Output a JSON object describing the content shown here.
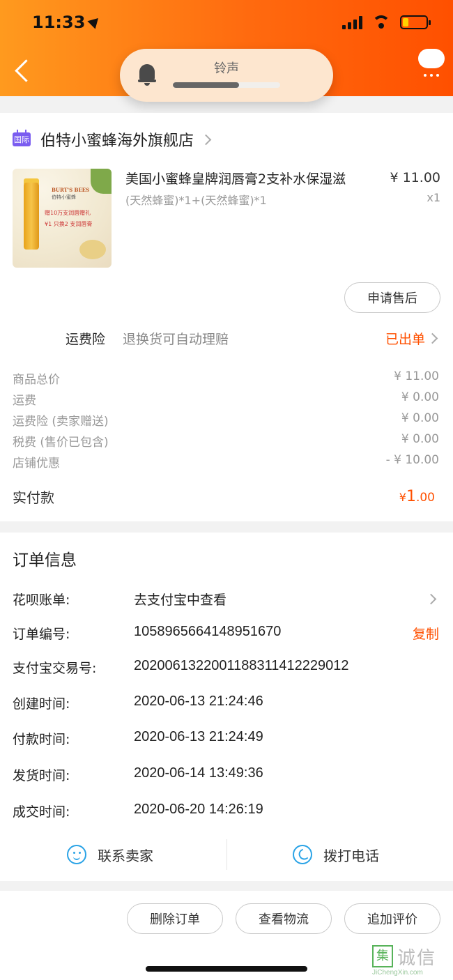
{
  "status_bar": {
    "time": "11:33"
  },
  "ringer": {
    "label": "铃声",
    "level": 0.62
  },
  "shop": {
    "badge": "国际",
    "name": "伯特小蜜蜂海外旗舰店",
    "product": {
      "title": "美国小蜜蜂皇牌润唇膏2支补水保湿滋",
      "sku": "(天然蜂蜜)*1+(天然蜂蜜)*1",
      "price": "¥ 11.00",
      "qty": "x1",
      "image_text": {
        "brand": "BURT'S BEES",
        "sub": "伯特小蜜蜂",
        "gift": "赠10万支润唇赠礼",
        "promo": "¥1 只换2 支润唇膏"
      }
    },
    "after_sale_button": "申请售后",
    "insurance": {
      "label": "运费险",
      "desc": "退换货可自动理赔",
      "status": "已出单"
    },
    "fees": [
      {
        "label": "商品总价",
        "value": "¥ 11.00"
      },
      {
        "label": "运费",
        "value": "¥ 0.00"
      },
      {
        "label": "运费险 (卖家赠送)",
        "value": "¥ 0.00"
      },
      {
        "label": "税费 (售价已包含)",
        "value": "¥ 0.00"
      },
      {
        "label": "店铺优惠",
        "value": "- ¥ 10.00"
      }
    ],
    "total": {
      "label": "实付款",
      "currency": "¥",
      "integer": "1",
      "decimal": ".00"
    }
  },
  "order_info": {
    "title": "订单信息",
    "huabei": {
      "label": "花呗账单:",
      "value": "去支付宝中查看"
    },
    "order_no": {
      "label": "订单编号:",
      "value": "1058965664148951670",
      "copy": "复制"
    },
    "alipay_no": {
      "label": "支付宝交易号:",
      "value": "2020061322001188311412229012"
    },
    "created": {
      "label": "创建时间:",
      "value": "2020-06-13 21:24:46"
    },
    "paid": {
      "label": "付款时间:",
      "value": "2020-06-13 21:24:49"
    },
    "shipped": {
      "label": "发货时间:",
      "value": "2020-06-14 13:49:36"
    },
    "completed": {
      "label": "成交时间:",
      "value": "2020-06-20 14:26:19"
    },
    "contact_seller": "联系卖家",
    "call": "拨打电话"
  },
  "actions": {
    "delete": "删除订单",
    "logistics": "查看物流",
    "review": "追加评价"
  },
  "watermark": {
    "seal": "集",
    "cn": "诚信",
    "en": "JiChengXin.com"
  },
  "colors": {
    "accent": "#ff5000",
    "header_start": "#ff9a1e",
    "header_end": "#ff5000",
    "icon_blue": "#2aa3e6"
  }
}
